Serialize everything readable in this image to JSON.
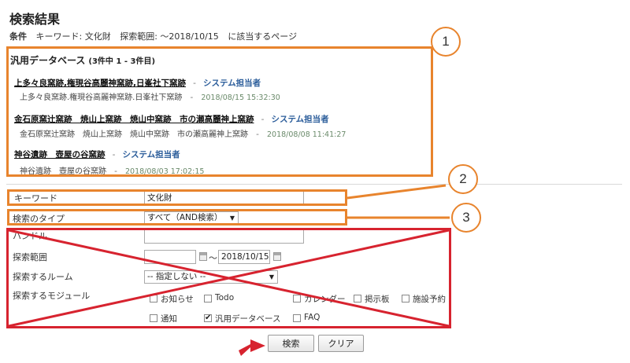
{
  "page": {
    "title": "検索結果",
    "condition_label": "条件",
    "keyword_part": "キーワード: 文化財",
    "range_part": "探索範囲: ～2018/10/15",
    "match_part": "に該当するページ"
  },
  "callouts": [
    "1",
    "2",
    "3"
  ],
  "results": {
    "section_title": "汎用データベース",
    "count_text": "(3件中 1 - 3件目)",
    "items": [
      {
        "title": "上多々良窯跡,権現谷高麗神窯跡,日峯社下窯跡",
        "sep": "-",
        "owner": "システム担当者",
        "path": "上多々良窯跡.権現谷高麗神窯跡.日峯社下窯跡",
        "time": "2018/08/15 15:32:30"
      },
      {
        "title": "金石原窯辻窯跡　焼山上窯跡　焼山中窯跡　市の瀬高麗神上窯跡",
        "sep": "-",
        "owner": "システム担当者",
        "path": "金石原窯辻窯跡　焼山上窯跡　焼山中窯跡　市の瀬高麗神上窯跡",
        "time": "2018/08/08 11:41:27"
      },
      {
        "title": "神谷遺跡　壺屋の谷窯跡",
        "sep": "-",
        "owner": "システム担当者",
        "path": "神谷遺跡　壺屋の谷窯跡",
        "time": "2018/08/03 17:02:15"
      }
    ]
  },
  "form": {
    "keyword_label": "キーワード",
    "keyword_value": "文化財",
    "type_label": "検索のタイプ",
    "type_value": "すべて（AND検索）",
    "handle_label": "ハンドル",
    "range_label": "探索範囲",
    "range_separator": "～",
    "range_end": "2018/10/15",
    "room_label": "探索するルーム",
    "room_value": "-- 指定しない --",
    "module_label": "探索するモジュール",
    "modules": [
      {
        "label": "お知らせ",
        "checked": false
      },
      {
        "label": "Todo",
        "checked": false
      },
      {
        "label": "カレンダー",
        "checked": false
      },
      {
        "label": "掲示板",
        "checked": false
      },
      {
        "label": "施設予約",
        "checked": false
      },
      {
        "label": "通知",
        "checked": false
      },
      {
        "label": "汎用データベース",
        "checked": true
      },
      {
        "label": "FAQ",
        "checked": false
      }
    ],
    "check_mark": "✔",
    "dropdown_arrow": "▼"
  },
  "buttons": {
    "search": "検索",
    "clear": "クリア"
  },
  "colors": {
    "annotation_orange": "#e8842d",
    "annotation_red": "#d7232f",
    "owner_link": "#2a5c9a"
  },
  "icons": {
    "arrow": "red-arrow-icon",
    "calendar": "calendar-icon",
    "dropdown": "chevron-down-icon"
  }
}
